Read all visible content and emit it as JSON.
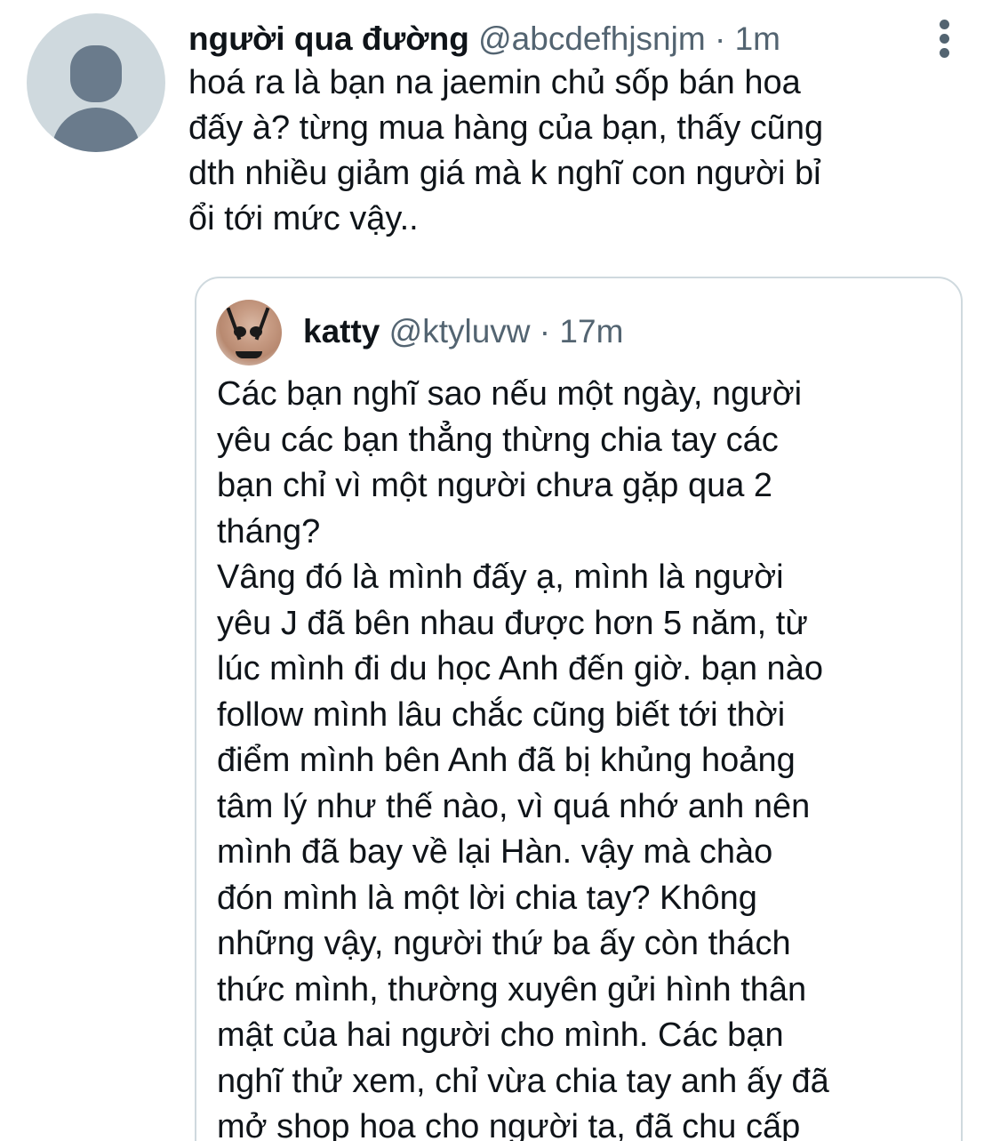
{
  "tweet": {
    "display_name": "người qua đường",
    "handle": "@abcdefhjsnjm",
    "separator": " · ",
    "time": "1m",
    "text_lines": [
      "hoá ra là bạn na jaemin chủ sốp bán hoa",
      "đấy à? từng mua hàng của bạn, thấy cũng",
      "dth nhiều giảm giá mà k nghĩ con người bỉ",
      "ổi tới mức vậy.."
    ],
    "more_icon": "more-vertical-icon",
    "avatar_icon": "default-profile-icon"
  },
  "quote": {
    "display_name": "katty",
    "handle": "@ktyluvw",
    "separator": " · ",
    "time": "17m",
    "text_lines": [
      "Các bạn nghĩ sao nếu một ngày, người",
      "yêu các bạn thẳng thừng chia tay các",
      "bạn chỉ vì một người chưa gặp qua 2",
      "tháng?",
      "Vâng đó là mình đấy ạ, mình là người",
      "yêu J đã bên nhau được hơn 5 năm, từ",
      "lúc mình đi du học Anh đến giờ. bạn nào",
      "follow mình lâu chắc cũng biết tới thời",
      "điểm mình bên Anh đã bị khủng hoảng",
      "tâm lý như thế nào, vì quá nhớ anh nên",
      "mình đã bay về lại Hàn. vậy mà chào",
      "đón mình là một lời chia tay? Không",
      "những vậy, người thứ ba ấy còn thách",
      "thức mình, thường xuyên gửi hình thân",
      "mật của hai người cho mình. Các bạn",
      "nghĩ thử xem, chỉ vừa chia tay anh ấy đã",
      "mở shop hoa cho người ta, đã chu cấp"
    ]
  },
  "colors": {
    "text": "#0f1419",
    "secondary": "#536471",
    "border": "#cfd9de",
    "avatar_bg": "#cfd9de",
    "avatar_fg": "#6a7b8c"
  }
}
